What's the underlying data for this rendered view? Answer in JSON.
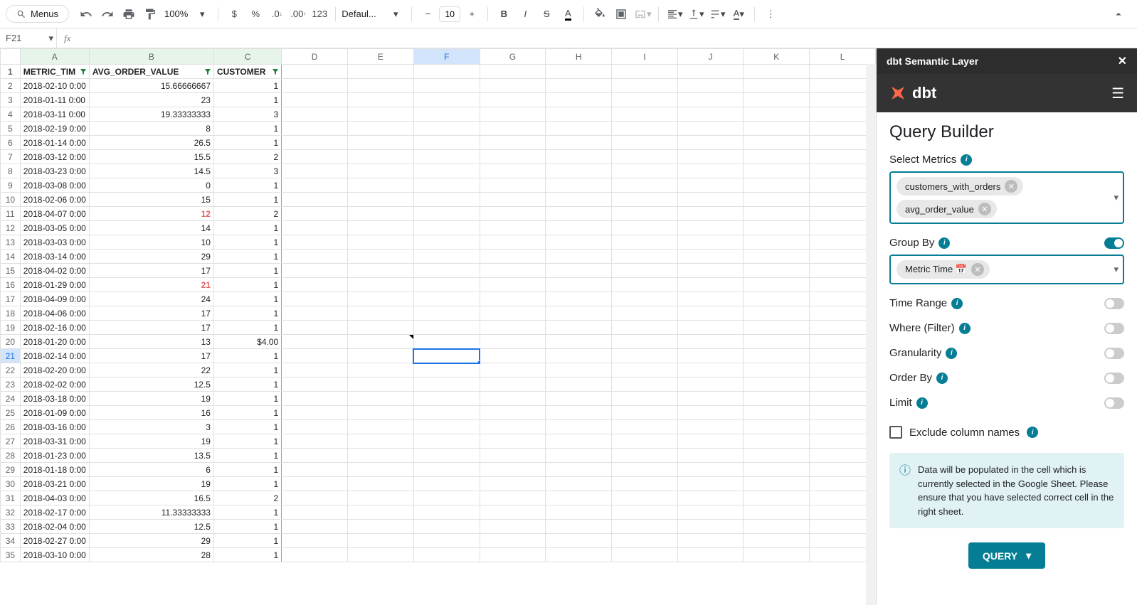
{
  "toolbar": {
    "menus_label": "Menus",
    "zoom": "100%",
    "font": "Defaul...",
    "font_size": "10",
    "format_number": "123"
  },
  "name_box": "F21",
  "columns": [
    "A",
    "B",
    "C",
    "D",
    "E",
    "F",
    "G",
    "H",
    "I",
    "J",
    "K",
    "L"
  ],
  "headers": {
    "a": "METRIC_TIM",
    "b": "AVG_ORDER_VALUE",
    "c": "CUSTOMER"
  },
  "rows": [
    {
      "n": 1,
      "a": "2018-02-10 0:00",
      "b": "15.66666667",
      "c": "1"
    },
    {
      "n": 2,
      "a": "2018-01-11 0:00",
      "b": "23",
      "c": "1"
    },
    {
      "n": 3,
      "a": "2018-03-11 0:00",
      "b": "19.33333333",
      "c": "3"
    },
    {
      "n": 4,
      "a": "2018-02-19 0:00",
      "b": "8",
      "c": "1"
    },
    {
      "n": 5,
      "a": "2018-01-14 0:00",
      "b": "26.5",
      "c": "1"
    },
    {
      "n": 6,
      "a": "2018-03-12 0:00",
      "b": "15.5",
      "c": "2"
    },
    {
      "n": 7,
      "a": "2018-03-23 0:00",
      "b": "14.5",
      "c": "3"
    },
    {
      "n": 8,
      "a": "2018-03-08 0:00",
      "b": "0",
      "c": "1"
    },
    {
      "n": 9,
      "a": "2018-02-06 0:00",
      "b": "15",
      "c": "1"
    },
    {
      "n": 10,
      "a": "2018-04-07 0:00",
      "b": "12",
      "c": "2",
      "hl": true
    },
    {
      "n": 11,
      "a": "2018-03-05 0:00",
      "b": "14",
      "c": "1"
    },
    {
      "n": 12,
      "a": "2018-03-03 0:00",
      "b": "10",
      "c": "1"
    },
    {
      "n": 13,
      "a": "2018-03-14 0:00",
      "b": "29",
      "c": "1"
    },
    {
      "n": 14,
      "a": "2018-04-02 0:00",
      "b": "17",
      "c": "1"
    },
    {
      "n": 15,
      "a": "2018-01-29 0:00",
      "b": "21",
      "c": "1",
      "hl": true
    },
    {
      "n": 16,
      "a": "2018-04-09 0:00",
      "b": "24",
      "c": "1"
    },
    {
      "n": 17,
      "a": "2018-04-06 0:00",
      "b": "17",
      "c": "1"
    },
    {
      "n": 18,
      "a": "2018-02-16 0:00",
      "b": "17",
      "c": "1"
    },
    {
      "n": 19,
      "a": "2018-01-20 0:00",
      "b": "13",
      "c": "$4.00"
    },
    {
      "n": 20,
      "a": "2018-02-14 0:00",
      "b": "17",
      "c": "1"
    },
    {
      "n": 21,
      "a": "2018-02-20 0:00",
      "b": "22",
      "c": "1"
    },
    {
      "n": 22,
      "a": "2018-02-02 0:00",
      "b": "12.5",
      "c": "1"
    },
    {
      "n": 23,
      "a": "2018-03-18 0:00",
      "b": "19",
      "c": "1"
    },
    {
      "n": 24,
      "a": "2018-01-09 0:00",
      "b": "16",
      "c": "1"
    },
    {
      "n": 25,
      "a": "2018-03-16 0:00",
      "b": "3",
      "c": "1"
    },
    {
      "n": 26,
      "a": "2018-03-31 0:00",
      "b": "19",
      "c": "1"
    },
    {
      "n": 27,
      "a": "2018-01-23 0:00",
      "b": "13.5",
      "c": "1"
    },
    {
      "n": 28,
      "a": "2018-01-18 0:00",
      "b": "6",
      "c": "1"
    },
    {
      "n": 29,
      "a": "2018-03-21 0:00",
      "b": "19",
      "c": "1"
    },
    {
      "n": 30,
      "a": "2018-04-03 0:00",
      "b": "16.5",
      "c": "2"
    },
    {
      "n": 31,
      "a": "2018-02-17 0:00",
      "b": "11.33333333",
      "c": "1"
    },
    {
      "n": 32,
      "a": "2018-02-04 0:00",
      "b": "12.5",
      "c": "1"
    },
    {
      "n": 33,
      "a": "2018-02-27 0:00",
      "b": "29",
      "c": "1"
    },
    {
      "n": 34,
      "a": "2018-03-10 0:00",
      "b": "28",
      "c": "1"
    }
  ],
  "panel": {
    "title": "dbt Semantic Layer",
    "brand": "dbt",
    "heading": "Query Builder",
    "select_metrics": "Select Metrics",
    "metrics": [
      "customers_with_orders",
      "avg_order_value"
    ],
    "group_by": "Group By",
    "group_chips": [
      "Metric Time 📅"
    ],
    "time_range": "Time Range",
    "where": "Where (Filter)",
    "granularity": "Granularity",
    "order_by": "Order By",
    "limit": "Limit",
    "exclude": "Exclude column names",
    "info": "Data will be populated in the cell which is currently selected in the Google Sheet. Please ensure that you have selected correct cell in the right sheet.",
    "query_btn": "QUERY"
  }
}
